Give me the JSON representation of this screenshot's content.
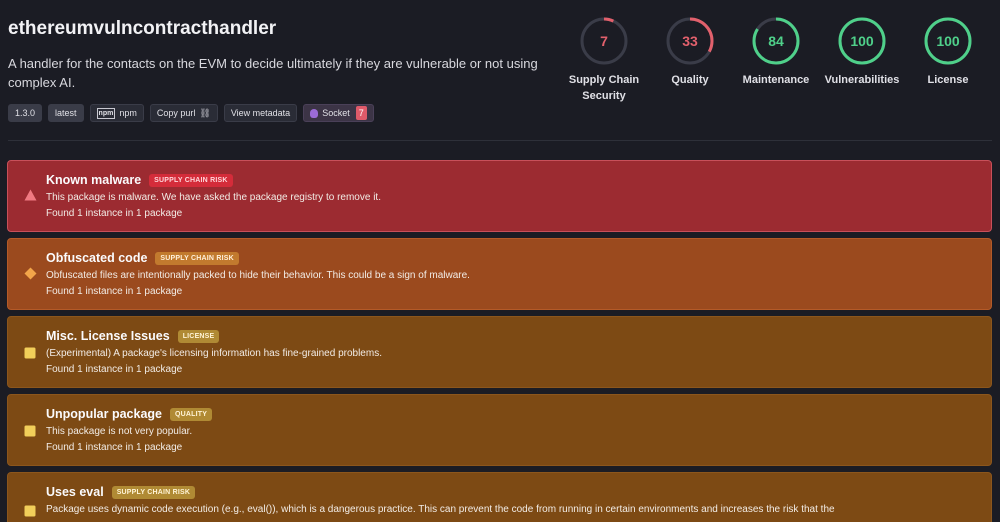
{
  "package": {
    "name": "ethereumvulncontracthandler",
    "description": "A handler for the contacts on the EVM to decide ultimately if they are vulnerable or not using complex AI.",
    "tags": {
      "version": "1.3.0",
      "latest": "latest",
      "registry": "npm",
      "registry_logo": "npm",
      "copy_purl": "Copy purl",
      "view_metadata": "View metadata",
      "socket": "Socket",
      "socket_count": "7"
    }
  },
  "scores": [
    {
      "label": "Supply Chain Security",
      "value": 7,
      "color": "#e2606c"
    },
    {
      "label": "Quality",
      "value": 33,
      "color": "#e2606c"
    },
    {
      "label": "Maintenance",
      "value": 84,
      "color": "#4fd08a"
    },
    {
      "label": "Vulnerabilities",
      "value": 100,
      "color": "#4fd08a"
    },
    {
      "label": "License",
      "value": 100,
      "color": "#4fd08a"
    }
  ],
  "alerts": [
    {
      "title": "Known malware",
      "category": "SUPPLY CHAIN RISK",
      "description": "This package is malware. We have asked the package registry to remove it.",
      "found": "Found 1 instance in 1 package",
      "icon": "triangle-warning-icon",
      "pill_bg": "#d42c3a",
      "pill_fg": "#ffd6da"
    },
    {
      "title": "Obfuscated code",
      "category": "SUPPLY CHAIN RISK",
      "description": "Obfuscated files are intentionally packed to hide their behavior. This could be a sign of malware.",
      "found": "Found 1 instance in 1 package",
      "icon": "diamond-warning-icon",
      "pill_bg": "#c27a2e",
      "pill_fg": "#fff0dc"
    },
    {
      "title": "Misc. License Issues",
      "category": "LICENSE",
      "description": "(Experimental) A package's licensing information has fine-grained problems.",
      "found": "Found 1 instance in 1 package",
      "icon": "square-notice-icon",
      "pill_bg": "#b08a34",
      "pill_fg": "#fff4d6"
    },
    {
      "title": "Unpopular package",
      "category": "QUALITY",
      "description": "This package is not very popular.",
      "found": "Found 1 instance in 1 package",
      "icon": "square-notice-icon",
      "pill_bg": "#b08a34",
      "pill_fg": "#fff4d6"
    },
    {
      "title": "Uses eval",
      "category": "SUPPLY CHAIN RISK",
      "description": "Package uses dynamic code execution (e.g., eval()), which is a dangerous practice. This can prevent the code from running in certain environments and increases the risk that the",
      "found": "",
      "icon": "square-notice-icon",
      "pill_bg": "#b08a34",
      "pill_fg": "#fff4d6"
    }
  ]
}
